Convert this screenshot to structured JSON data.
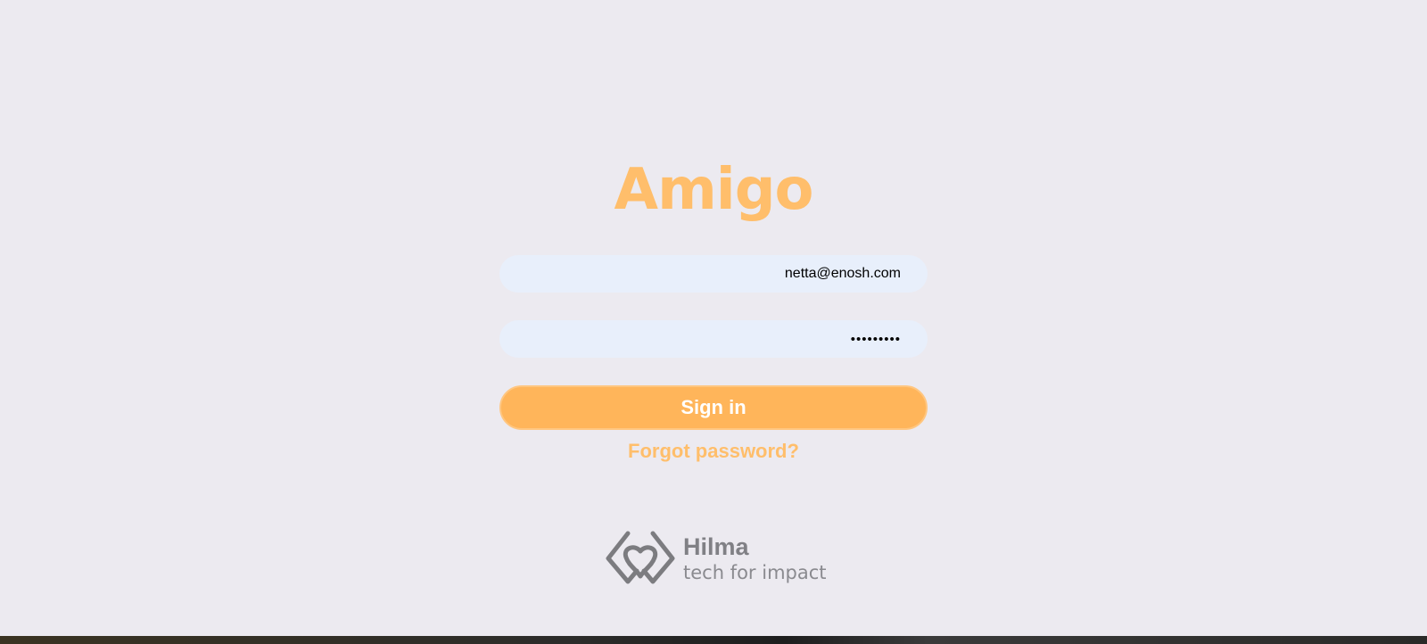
{
  "app": {
    "title": "Amigo"
  },
  "login_form": {
    "email_value": "netta@enosh.com",
    "password_value": "•••••••••",
    "sign_in_label": "Sign in",
    "forgot_password_label": "Forgot password?"
  },
  "footer": {
    "brand_name": "Hilma",
    "brand_tagline": "tech for impact",
    "logo_icon": "hilma-heart-diamond-icon"
  },
  "colors": {
    "background": "#eceaf0",
    "accent": "#ffb55a",
    "title": "#ffbe6b",
    "input_background": "#e8effb",
    "footer_text": "#808085"
  }
}
